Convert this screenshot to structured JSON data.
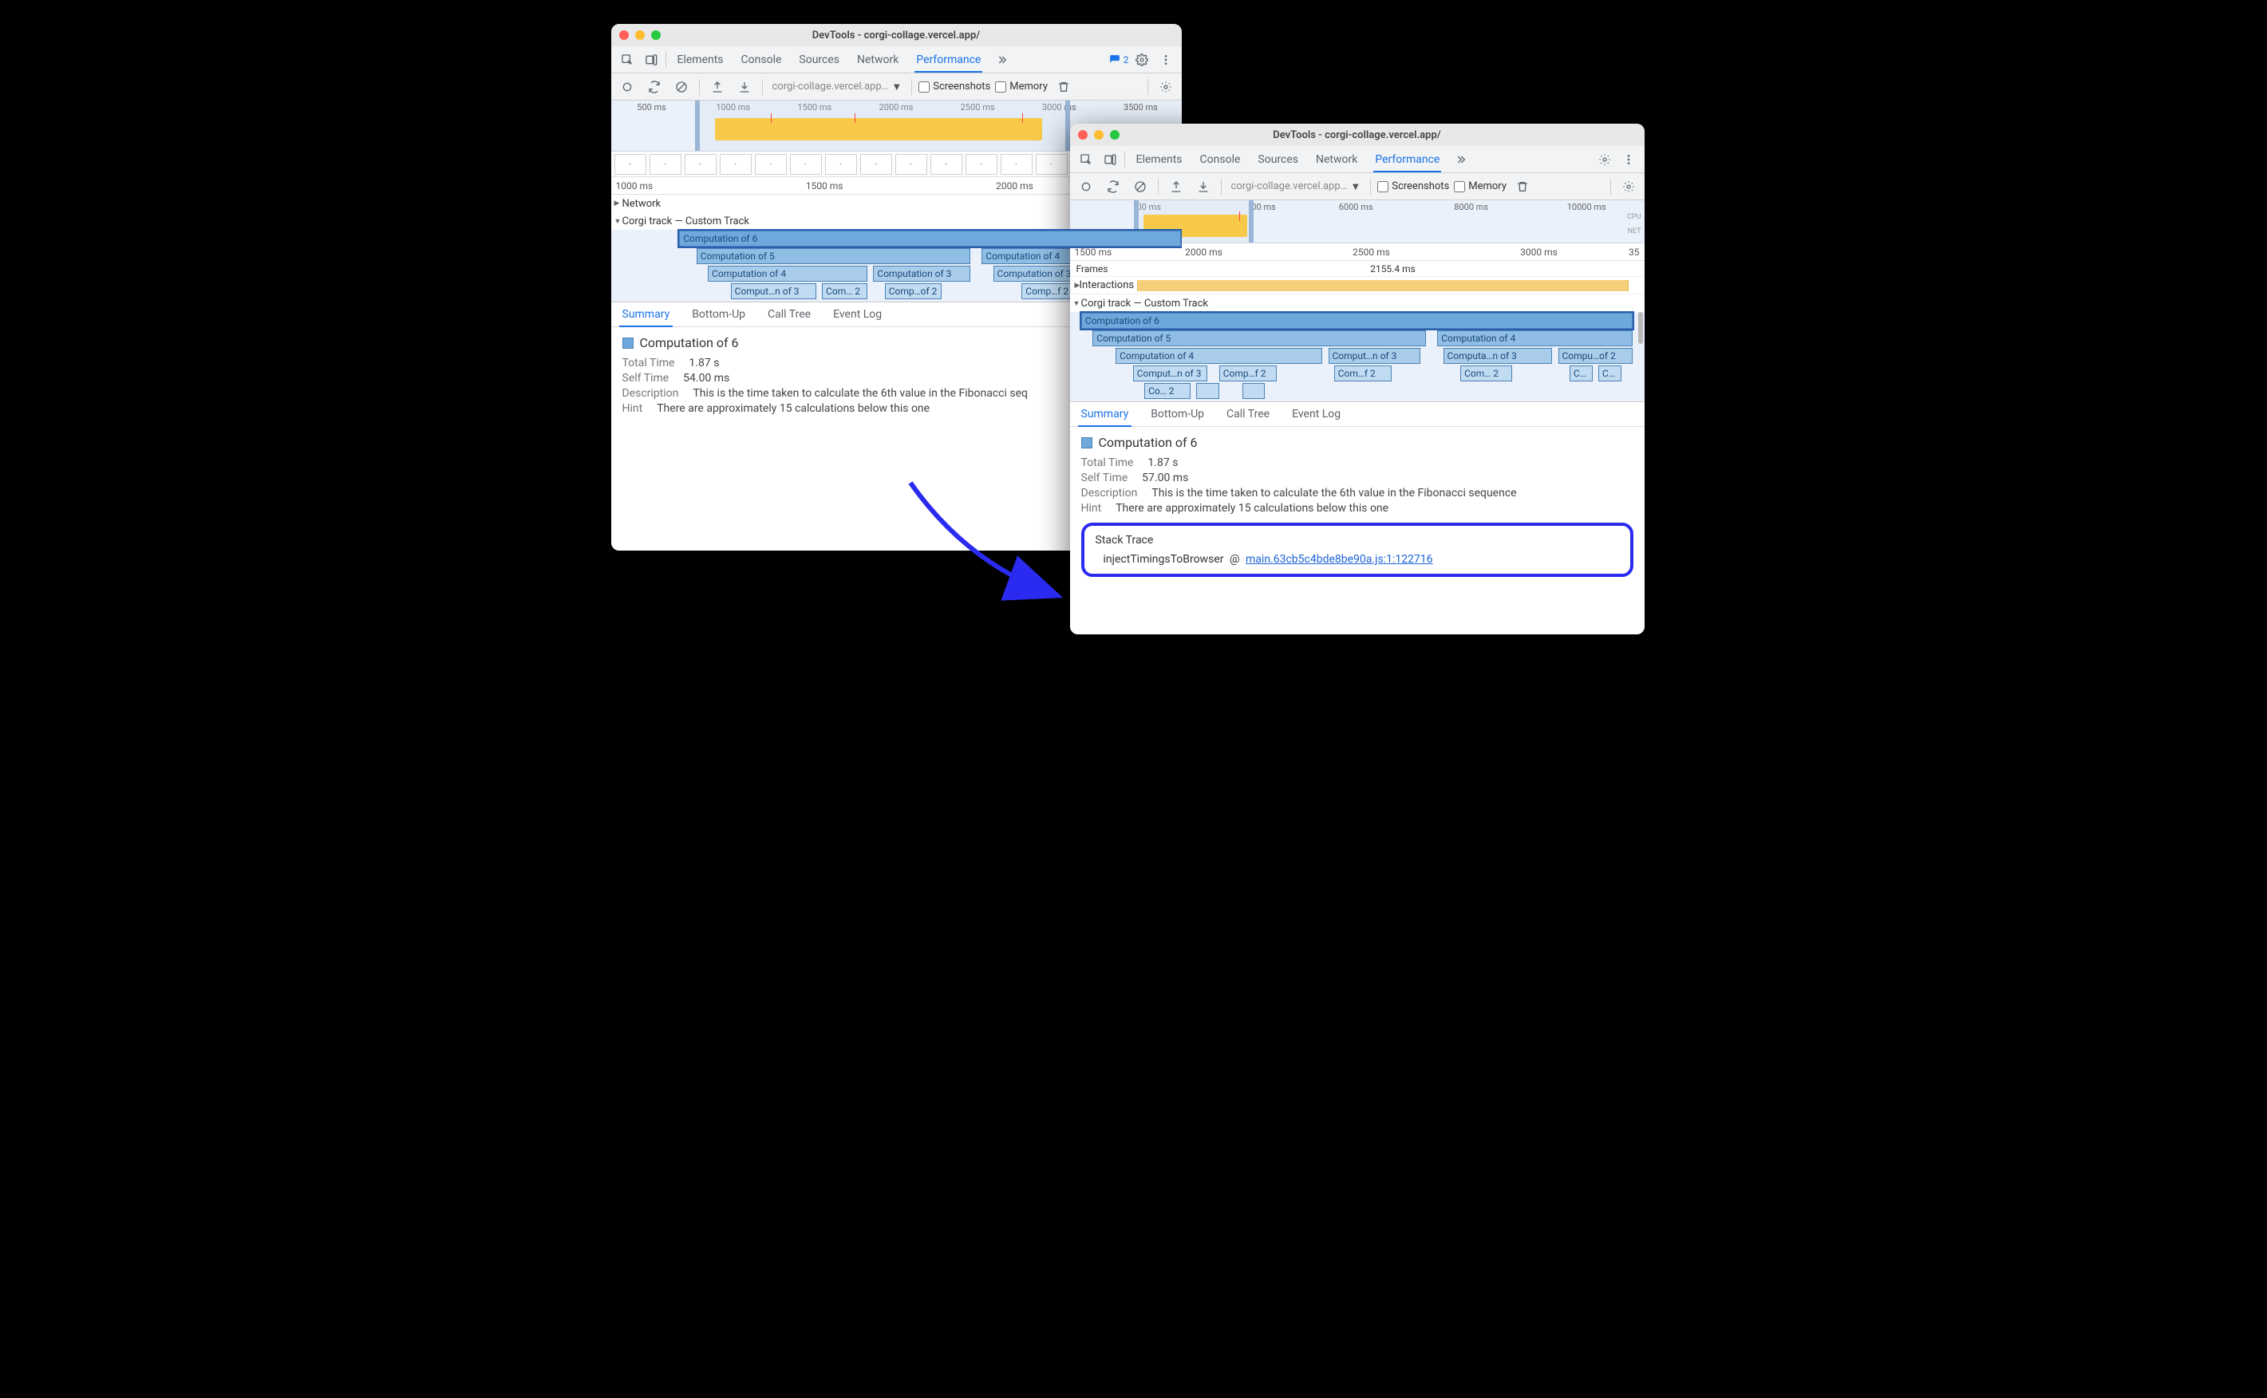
{
  "left": {
    "titlebar": "DevTools - corgi-collage.vercel.app/",
    "tabs": [
      "Elements",
      "Console",
      "Sources",
      "Network",
      "Performance"
    ],
    "activeTab": 4,
    "issuesCount": 2,
    "url": "corgi-collage.vercel.app…",
    "checkboxes": {
      "screenshots": "Screenshots",
      "memory": "Memory"
    },
    "overviewTicks": [
      "500 ms",
      "1000 ms",
      "1500 ms",
      "2000 ms",
      "2500 ms",
      "3000 ms",
      "3500 ms"
    ],
    "rulerTicks": [
      "1000 ms",
      "1500 ms",
      "2000 ms"
    ],
    "sections": {
      "network": "Network",
      "custom": "Corgi track — Custom Track"
    },
    "flame": {
      "row0": [
        {
          "l": 12,
          "w": 88,
          "t": "Computation of 6",
          "sel": true
        }
      ],
      "row1": [
        {
          "l": 15,
          "w": 48,
          "t": "Computation of 5"
        },
        {
          "l": 65,
          "w": 35,
          "t": "Computation of 4"
        }
      ],
      "row2": [
        {
          "l": 17,
          "w": 28,
          "t": "Computation of 4"
        },
        {
          "l": 46,
          "w": 17,
          "t": "Computation of 3"
        },
        {
          "l": 67,
          "w": 18,
          "t": "Computation of 3"
        }
      ],
      "row3": [
        {
          "l": 21,
          "w": 15,
          "t": "Comput…n of 3"
        },
        {
          "l": 37,
          "w": 8,
          "t": "Com… 2"
        },
        {
          "l": 48,
          "w": 10,
          "t": "Comp…of 2"
        },
        {
          "l": 72,
          "w": 9,
          "t": "Comp…f 2"
        }
      ]
    },
    "detailTabs": [
      "Summary",
      "Bottom-Up",
      "Call Tree",
      "Event Log"
    ],
    "summary": {
      "title": "Computation of 6",
      "rows": {
        "totalTimeK": "Total Time",
        "totalTimeV": "1.87 s",
        "selfTimeK": "Self Time",
        "selfTimeV": "54.00 ms",
        "descK": "Description",
        "descV": "This is the time taken to calculate the 6th value in the Fibonacci seq",
        "hintK": "Hint",
        "hintV": "There are approximately 15 calculations below this one"
      }
    }
  },
  "right": {
    "titlebar": "DevTools - corgi-collage.vercel.app/",
    "tabs": [
      "Elements",
      "Console",
      "Sources",
      "Network",
      "Performance"
    ],
    "activeTab": 4,
    "url": "corgi-collage.vercel.app…",
    "checkboxes": {
      "screenshots": "Screenshots",
      "memory": "Memory"
    },
    "overviewTicks": [
      "00 ms",
      "00 ms",
      "6000 ms",
      "8000 ms",
      "10000 ms"
    ],
    "rulerTicksL": "1500 ms",
    "rulerTicks2": "2000 ms",
    "rulerTicks3": "2500 ms",
    "rulerTicks4": "3000 ms",
    "rulerTicksR": "35",
    "framesLabel": "Frames",
    "framesValue": "2155.4 ms",
    "interactions": "Interactions",
    "sections": {
      "custom": "Corgi track — Custom Track"
    },
    "flame": {
      "row0": [
        {
          "l": 2,
          "w": 96,
          "t": "Computation of 6",
          "sel": true
        }
      ],
      "row1": [
        {
          "l": 4,
          "w": 58,
          "t": "Computation of 5"
        },
        {
          "l": 64,
          "w": 34,
          "t": "Computation of 4"
        }
      ],
      "row2": [
        {
          "l": 8,
          "w": 36,
          "t": "Computation of 4"
        },
        {
          "l": 45,
          "w": 16,
          "t": "Comput…n of 3"
        },
        {
          "l": 65,
          "w": 19,
          "t": "Computa…n of 3"
        },
        {
          "l": 85,
          "w": 13,
          "t": "Compu…of 2"
        }
      ],
      "row3": [
        {
          "l": 11,
          "w": 13,
          "t": "Comput…n of 3"
        },
        {
          "l": 26,
          "w": 10,
          "t": "Comp…f 2"
        },
        {
          "l": 46,
          "w": 10,
          "t": "Com…f 2"
        },
        {
          "l": 68,
          "w": 9,
          "t": "Com… 2"
        },
        {
          "l": 87,
          "w": 4,
          "t": "C…"
        },
        {
          "l": 92,
          "w": 4,
          "t": "C…"
        }
      ],
      "row4": [
        {
          "l": 13,
          "w": 8,
          "t": "Co… 2"
        },
        {
          "l": 22,
          "w": 4,
          "t": ""
        },
        {
          "l": 30,
          "w": 4,
          "t": ""
        }
      ]
    },
    "detailTabs": [
      "Summary",
      "Bottom-Up",
      "Call Tree",
      "Event Log"
    ],
    "summary": {
      "title": "Computation of 6",
      "rows": {
        "totalTimeK": "Total Time",
        "totalTimeV": "1.87 s",
        "selfTimeK": "Self Time",
        "selfTimeV": "57.00 ms",
        "descK": "Description",
        "descV": "This is the time taken to calculate the 6th value in the Fibonacci sequence",
        "hintK": "Hint",
        "hintV": "There are approximately 15 calculations below this one"
      }
    },
    "stack": {
      "heading": "Stack Trace",
      "fn": "injectTimingsToBrowser",
      "at": "@",
      "link": "main.63cb5c4bde8be90a.js:1:122716"
    }
  }
}
